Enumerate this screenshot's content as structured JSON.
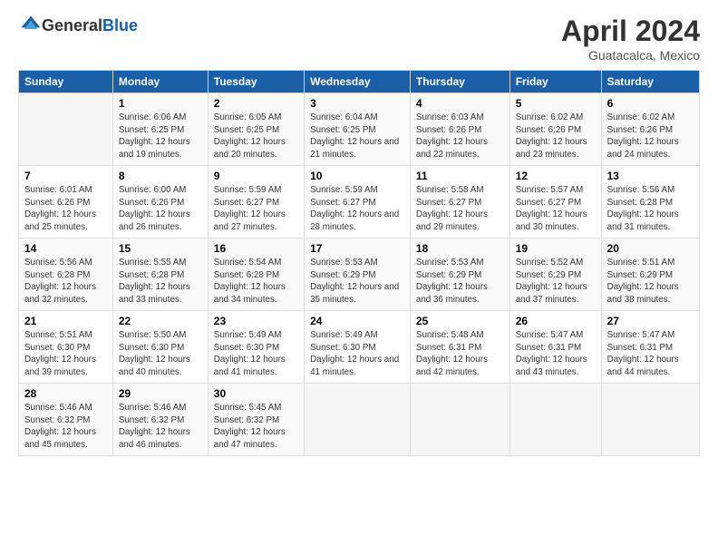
{
  "header": {
    "logo_general": "General",
    "logo_blue": "Blue",
    "month_year": "April 2024",
    "location": "Guatacalca, Mexico"
  },
  "days_of_week": [
    "Sunday",
    "Monday",
    "Tuesday",
    "Wednesday",
    "Thursday",
    "Friday",
    "Saturday"
  ],
  "weeks": [
    [
      {
        "day": "",
        "sunrise": "",
        "sunset": "",
        "daylight": ""
      },
      {
        "day": "1",
        "sunrise": "Sunrise: 6:06 AM",
        "sunset": "Sunset: 6:25 PM",
        "daylight": "Daylight: 12 hours and 19 minutes."
      },
      {
        "day": "2",
        "sunrise": "Sunrise: 6:05 AM",
        "sunset": "Sunset: 6:25 PM",
        "daylight": "Daylight: 12 hours and 20 minutes."
      },
      {
        "day": "3",
        "sunrise": "Sunrise: 6:04 AM",
        "sunset": "Sunset: 6:25 PM",
        "daylight": "Daylight: 12 hours and 21 minutes."
      },
      {
        "day": "4",
        "sunrise": "Sunrise: 6:03 AM",
        "sunset": "Sunset: 6:26 PM",
        "daylight": "Daylight: 12 hours and 22 minutes."
      },
      {
        "day": "5",
        "sunrise": "Sunrise: 6:02 AM",
        "sunset": "Sunset: 6:26 PM",
        "daylight": "Daylight: 12 hours and 23 minutes."
      },
      {
        "day": "6",
        "sunrise": "Sunrise: 6:02 AM",
        "sunset": "Sunset: 6:26 PM",
        "daylight": "Daylight: 12 hours and 24 minutes."
      }
    ],
    [
      {
        "day": "7",
        "sunrise": "Sunrise: 6:01 AM",
        "sunset": "Sunset: 6:26 PM",
        "daylight": "Daylight: 12 hours and 25 minutes."
      },
      {
        "day": "8",
        "sunrise": "Sunrise: 6:00 AM",
        "sunset": "Sunset: 6:26 PM",
        "daylight": "Daylight: 12 hours and 26 minutes."
      },
      {
        "day": "9",
        "sunrise": "Sunrise: 5:59 AM",
        "sunset": "Sunset: 6:27 PM",
        "daylight": "Daylight: 12 hours and 27 minutes."
      },
      {
        "day": "10",
        "sunrise": "Sunrise: 5:59 AM",
        "sunset": "Sunset: 6:27 PM",
        "daylight": "Daylight: 12 hours and 28 minutes."
      },
      {
        "day": "11",
        "sunrise": "Sunrise: 5:58 AM",
        "sunset": "Sunset: 6:27 PM",
        "daylight": "Daylight: 12 hours and 29 minutes."
      },
      {
        "day": "12",
        "sunrise": "Sunrise: 5:57 AM",
        "sunset": "Sunset: 6:27 PM",
        "daylight": "Daylight: 12 hours and 30 minutes."
      },
      {
        "day": "13",
        "sunrise": "Sunrise: 5:56 AM",
        "sunset": "Sunset: 6:28 PM",
        "daylight": "Daylight: 12 hours and 31 minutes."
      }
    ],
    [
      {
        "day": "14",
        "sunrise": "Sunrise: 5:56 AM",
        "sunset": "Sunset: 6:28 PM",
        "daylight": "Daylight: 12 hours and 32 minutes."
      },
      {
        "day": "15",
        "sunrise": "Sunrise: 5:55 AM",
        "sunset": "Sunset: 6:28 PM",
        "daylight": "Daylight: 12 hours and 33 minutes."
      },
      {
        "day": "16",
        "sunrise": "Sunrise: 5:54 AM",
        "sunset": "Sunset: 6:28 PM",
        "daylight": "Daylight: 12 hours and 34 minutes."
      },
      {
        "day": "17",
        "sunrise": "Sunrise: 5:53 AM",
        "sunset": "Sunset: 6:29 PM",
        "daylight": "Daylight: 12 hours and 35 minutes."
      },
      {
        "day": "18",
        "sunrise": "Sunrise: 5:53 AM",
        "sunset": "Sunset: 6:29 PM",
        "daylight": "Daylight: 12 hours and 36 minutes."
      },
      {
        "day": "19",
        "sunrise": "Sunrise: 5:52 AM",
        "sunset": "Sunset: 6:29 PM",
        "daylight": "Daylight: 12 hours and 37 minutes."
      },
      {
        "day": "20",
        "sunrise": "Sunrise: 5:51 AM",
        "sunset": "Sunset: 6:29 PM",
        "daylight": "Daylight: 12 hours and 38 minutes."
      }
    ],
    [
      {
        "day": "21",
        "sunrise": "Sunrise: 5:51 AM",
        "sunset": "Sunset: 6:30 PM",
        "daylight": "Daylight: 12 hours and 39 minutes."
      },
      {
        "day": "22",
        "sunrise": "Sunrise: 5:50 AM",
        "sunset": "Sunset: 6:30 PM",
        "daylight": "Daylight: 12 hours and 40 minutes."
      },
      {
        "day": "23",
        "sunrise": "Sunrise: 5:49 AM",
        "sunset": "Sunset: 6:30 PM",
        "daylight": "Daylight: 12 hours and 41 minutes."
      },
      {
        "day": "24",
        "sunrise": "Sunrise: 5:49 AM",
        "sunset": "Sunset: 6:30 PM",
        "daylight": "Daylight: 12 hours and 41 minutes."
      },
      {
        "day": "25",
        "sunrise": "Sunrise: 5:48 AM",
        "sunset": "Sunset: 6:31 PM",
        "daylight": "Daylight: 12 hours and 42 minutes."
      },
      {
        "day": "26",
        "sunrise": "Sunrise: 5:47 AM",
        "sunset": "Sunset: 6:31 PM",
        "daylight": "Daylight: 12 hours and 43 minutes."
      },
      {
        "day": "27",
        "sunrise": "Sunrise: 5:47 AM",
        "sunset": "Sunset: 6:31 PM",
        "daylight": "Daylight: 12 hours and 44 minutes."
      }
    ],
    [
      {
        "day": "28",
        "sunrise": "Sunrise: 5:46 AM",
        "sunset": "Sunset: 6:32 PM",
        "daylight": "Daylight: 12 hours and 45 minutes."
      },
      {
        "day": "29",
        "sunrise": "Sunrise: 5:46 AM",
        "sunset": "Sunset: 6:32 PM",
        "daylight": "Daylight: 12 hours and 46 minutes."
      },
      {
        "day": "30",
        "sunrise": "Sunrise: 5:45 AM",
        "sunset": "Sunset: 6:32 PM",
        "daylight": "Daylight: 12 hours and 47 minutes."
      },
      {
        "day": "",
        "sunrise": "",
        "sunset": "",
        "daylight": ""
      },
      {
        "day": "",
        "sunrise": "",
        "sunset": "",
        "daylight": ""
      },
      {
        "day": "",
        "sunrise": "",
        "sunset": "",
        "daylight": ""
      },
      {
        "day": "",
        "sunrise": "",
        "sunset": "",
        "daylight": ""
      }
    ]
  ]
}
